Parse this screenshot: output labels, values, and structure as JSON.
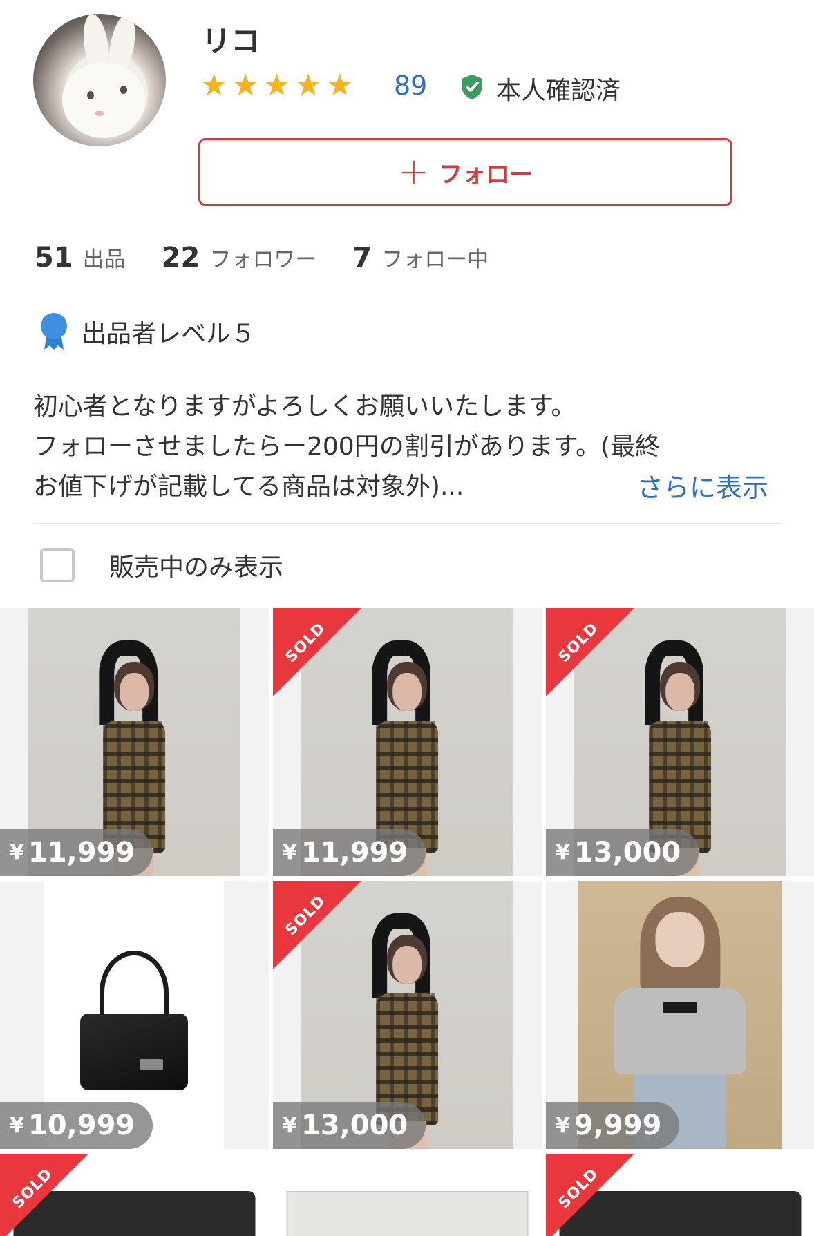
{
  "profile": {
    "name": "リコ",
    "rating_count": "89",
    "stars": [
      "★",
      "★",
      "★",
      "★",
      "★"
    ],
    "verified_label": "本人確認済"
  },
  "follow_button": {
    "plus": "+",
    "label": "フォロー"
  },
  "stats": [
    {
      "value": "51",
      "label": "出品"
    },
    {
      "value": "22",
      "label": "フォロワー"
    },
    {
      "value": "7",
      "label": "フォロー中"
    }
  ],
  "seller_level": "出品者レベル５",
  "bio": {
    "line1": "初心者となりますがよろしくお願いいたします。",
    "line2": "フォローさせましたらー200円の割引があります。(最終",
    "line3": "お値下げが記載してる商品は対象外)...",
    "show_more": "さらに表示"
  },
  "filter": {
    "label": "販売中のみ表示",
    "checked": false
  },
  "items": [
    {
      "price": "11,999",
      "sold": false,
      "image": "checkered-dress"
    },
    {
      "price": "11,999",
      "sold": true,
      "image": "checkered-dress"
    },
    {
      "price": "13,000",
      "sold": true,
      "image": "checkered-dress"
    },
    {
      "price": "10,999",
      "sold": false,
      "image": "black-handbag"
    },
    {
      "price": "13,000",
      "sold": true,
      "image": "checkered-dress"
    },
    {
      "price": "9,999",
      "sold": false,
      "image": "grey-knit-top"
    },
    {
      "price": "",
      "sold": true,
      "image": "black-item-box"
    },
    {
      "price": "",
      "sold": false,
      "image": "white-box"
    },
    {
      "price": "",
      "sold": true,
      "image": "black-item-box"
    }
  ],
  "sold_label": "SOLD",
  "yen_symbol": "¥",
  "colors": {
    "accent_red": "#d63a3a",
    "sold_red": "#e8383d",
    "link_blue": "#2f6fc2",
    "star_yellow": "#f5b41f",
    "verified_green": "#3a9d5d",
    "level_blue": "#3e8fe0"
  }
}
